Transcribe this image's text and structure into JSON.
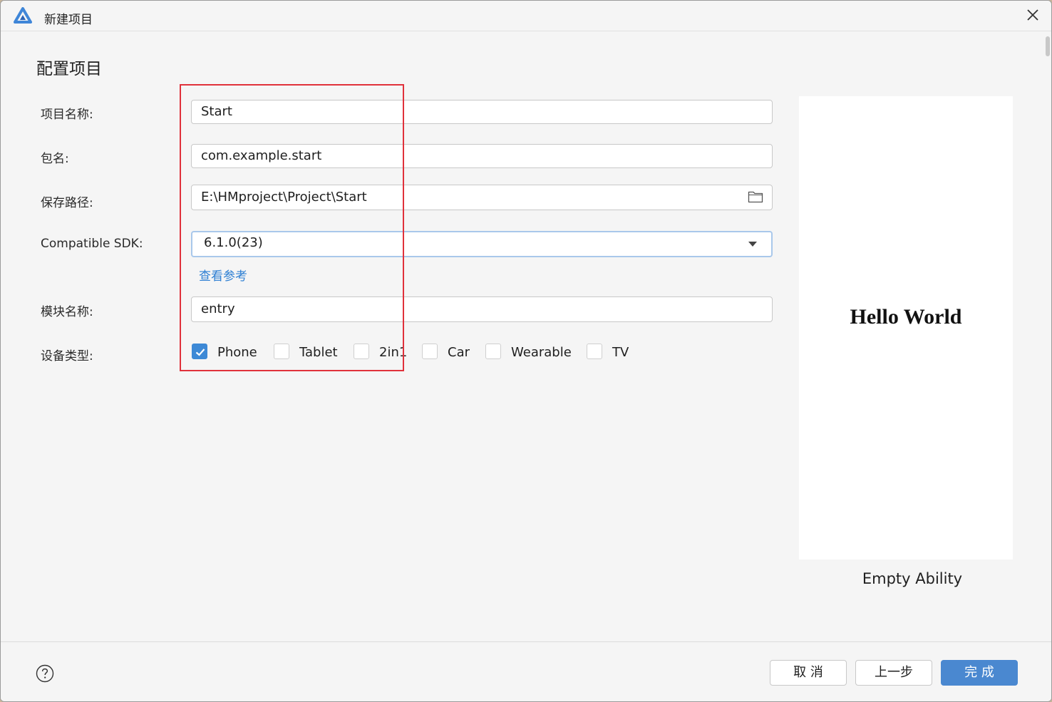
{
  "window": {
    "title": "新建项目",
    "icons": {
      "app": "deveco-logo-icon",
      "close": "close-icon"
    }
  },
  "page": {
    "heading": "配置项目"
  },
  "form": {
    "project_name": {
      "label": "项目名称:",
      "value": "Start"
    },
    "package_name": {
      "label": "包名:",
      "value": "com.example.start"
    },
    "save_path": {
      "label": "保存路径:",
      "value": "E:\\HMproject\\Project\\Start",
      "icon": "folder-icon"
    },
    "sdk": {
      "label": "Compatible SDK:",
      "value": "6.1.0(23)",
      "icon": "chevron-down-icon"
    },
    "reference_link": "查看参考",
    "module_name": {
      "label": "模块名称:",
      "value": "entry"
    },
    "device_type": {
      "label": "设备类型:",
      "options": [
        {
          "label": "Phone",
          "checked": true
        },
        {
          "label": "Tablet",
          "checked": false
        },
        {
          "label": "2in1",
          "checked": false
        },
        {
          "label": "Car",
          "checked": false
        },
        {
          "label": "Wearable",
          "checked": false
        },
        {
          "label": "TV",
          "checked": false
        }
      ]
    }
  },
  "preview": {
    "screen_text": "Hello World",
    "template_name": "Empty Ability"
  },
  "footer": {
    "help_icon": "help-circle-icon",
    "buttons": {
      "cancel": "取 消",
      "previous": "上一步",
      "finish": "完 成"
    }
  },
  "colors": {
    "accent": "#4a88d0",
    "link": "#2d7fd3",
    "annotation_box": "#e0313b",
    "checkbox_checked": "#3d89d6"
  }
}
